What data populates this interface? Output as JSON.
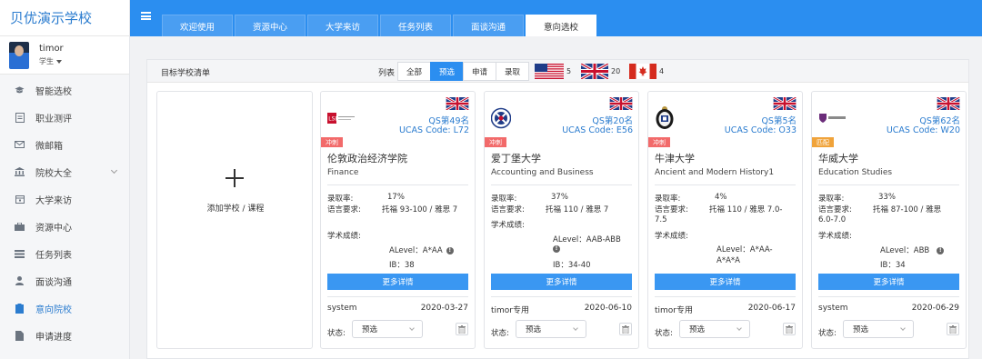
{
  "brand": "贝优演示学校",
  "user": {
    "name": "timor",
    "role": "学生"
  },
  "menu": [
    {
      "label": "智能选校",
      "icon": "graduation-cap-icon"
    },
    {
      "label": "职业测评",
      "icon": "clipboard-icon"
    },
    {
      "label": "微邮箱",
      "icon": "mail-icon"
    },
    {
      "label": "院校大全",
      "icon": "institution-icon"
    },
    {
      "label": "大学来访",
      "icon": "calendar-icon"
    },
    {
      "label": "资源中心",
      "icon": "briefcase-icon"
    },
    {
      "label": "任务列表",
      "icon": "list-icon"
    },
    {
      "label": "面谈沟通",
      "icon": "person-icon"
    },
    {
      "label": "意向院校",
      "icon": "bookmark-icon"
    },
    {
      "label": "申请进度",
      "icon": "document-icon"
    }
  ],
  "tabs": [
    "欢迎使用",
    "资源中心",
    "大学来访",
    "任务列表",
    "面谈沟通",
    "意向选校"
  ],
  "active_tab": 5,
  "filter": {
    "title": "目标学校清单",
    "label": "列表",
    "options": [
      "全部",
      "预选",
      "申请",
      "录取"
    ],
    "active": 1,
    "countries": [
      {
        "country": "US",
        "count": "5"
      },
      {
        "country": "UK",
        "count": "20"
      },
      {
        "country": "CA",
        "count": "4"
      }
    ]
  },
  "add_card": {
    "label": "添加学校 / 课程"
  },
  "labels": {
    "acceptance": "录取率:",
    "language": "语言要求:",
    "academic": "学术成绩:",
    "more": "更多详情",
    "status": "状态:"
  },
  "cards": [
    {
      "flag": "UK",
      "logo": "LSE",
      "qs": "QS第49名",
      "ucas": "UCAS Code: L72",
      "tag": "冲刺",
      "tag_color": "#f26a6a",
      "school": "伦敦政治经济学院",
      "course": "Finance",
      "acceptance_rate": "17%",
      "language_req": "托福 93-100 / 雅思 7",
      "alevel": "ALevel：A*AA",
      "ib": "IB：38",
      "creator": "system",
      "date": "2020-03-27",
      "status": "预选"
    },
    {
      "flag": "UK",
      "logo": "Edinburgh",
      "qs": "QS第20名",
      "ucas": "UCAS Code: E56",
      "tag": "冲刺",
      "tag_color": "#f26a6a",
      "school": "爱丁堡大学",
      "course": "Accounting and Business",
      "acceptance_rate": "37%",
      "language_req": "托福 110 / 雅思 7",
      "alevel": "ALevel：AAB-ABB",
      "ib": "IB：34-40",
      "creator": "timor专用",
      "date": "2020-06-10",
      "status": "预选"
    },
    {
      "flag": "UK",
      "logo": "Oxford",
      "qs": "QS第5名",
      "ucas": "UCAS Code: O33",
      "tag": "冲刺",
      "tag_color": "#f26a6a",
      "school": "牛津大学",
      "course": "Ancient and Modern History1",
      "acceptance_rate": "4%",
      "language_req": "托福 110 / 雅思 7.0-7.5",
      "alevel": "ALevel：A*AA-A*A*A",
      "ib": "",
      "creator": "timor专用",
      "date": "2020-06-17",
      "status": "预选"
    },
    {
      "flag": "UK",
      "logo": "Warwick",
      "qs": "QS第62名",
      "ucas": "UCAS Code: W20",
      "tag": "匹配",
      "tag_color": "#f0a33a",
      "school": "华威大学",
      "course": "Education Studies",
      "acceptance_rate": "33%",
      "language_req": "托福 87-100 / 雅思 6.0-7.0",
      "alevel": "ALevel：ABB",
      "ib": "IB：34",
      "creator": "system",
      "date": "2020-06-29",
      "status": "预选"
    }
  ]
}
